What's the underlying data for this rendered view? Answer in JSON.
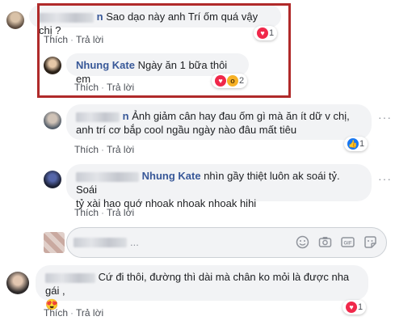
{
  "comments": [
    {
      "text": "Sao dạo này anh Trí ốm quá vậy chị ?",
      "like_label": "Thích",
      "reply_label": "Trả lời",
      "reaction_count": "1"
    },
    {
      "author": "Nhung Kate",
      "text": "Ngày ăn 1 bữa thôi em",
      "like_label": "Thích",
      "reply_label": "Trả lời",
      "reaction_count": "2"
    },
    {
      "name_tail": "n",
      "text_line1": "Ảnh giảm cân hay đau ốm gì mà ăn ít dữ v chị,",
      "text_line2": "anh trí cơ bắp cool ngầu ngày nào đâu mất tiêu",
      "like_label": "Thích",
      "reply_label": "Trả lời",
      "reaction_count": "1"
    },
    {
      "tag": "Nhung Kate",
      "text_line1": "nhìn gầy thiệt luôn ak soái tỷ. Soái",
      "text_line2": "tỷ xài hao quớ nhoak nhoak nhoak hihi",
      "like_label": "Thích",
      "reply_label": "Trả lời"
    },
    {
      "text": "Cứ đi thôi, đường thì dài mà chân ko mỏi là được nha gái ,",
      "emoji": "😍",
      "like_label": "Thích",
      "reply_label": "Trả lời",
      "reaction_count": "1"
    }
  ],
  "reply_input": {
    "placeholder": "..."
  },
  "separator": "·",
  "more_glyph": "···",
  "icons": [
    "heart-reaction-icon",
    "wow-reaction-icon",
    "like-reaction-icon",
    "smiley-icon",
    "camera-icon",
    "gif-icon",
    "sticker-icon",
    "more-options-icon"
  ],
  "colors": {
    "link": "#385898",
    "highlight_border": "#b02a2a",
    "heart": "#f0284a",
    "like": "#1877f2"
  }
}
